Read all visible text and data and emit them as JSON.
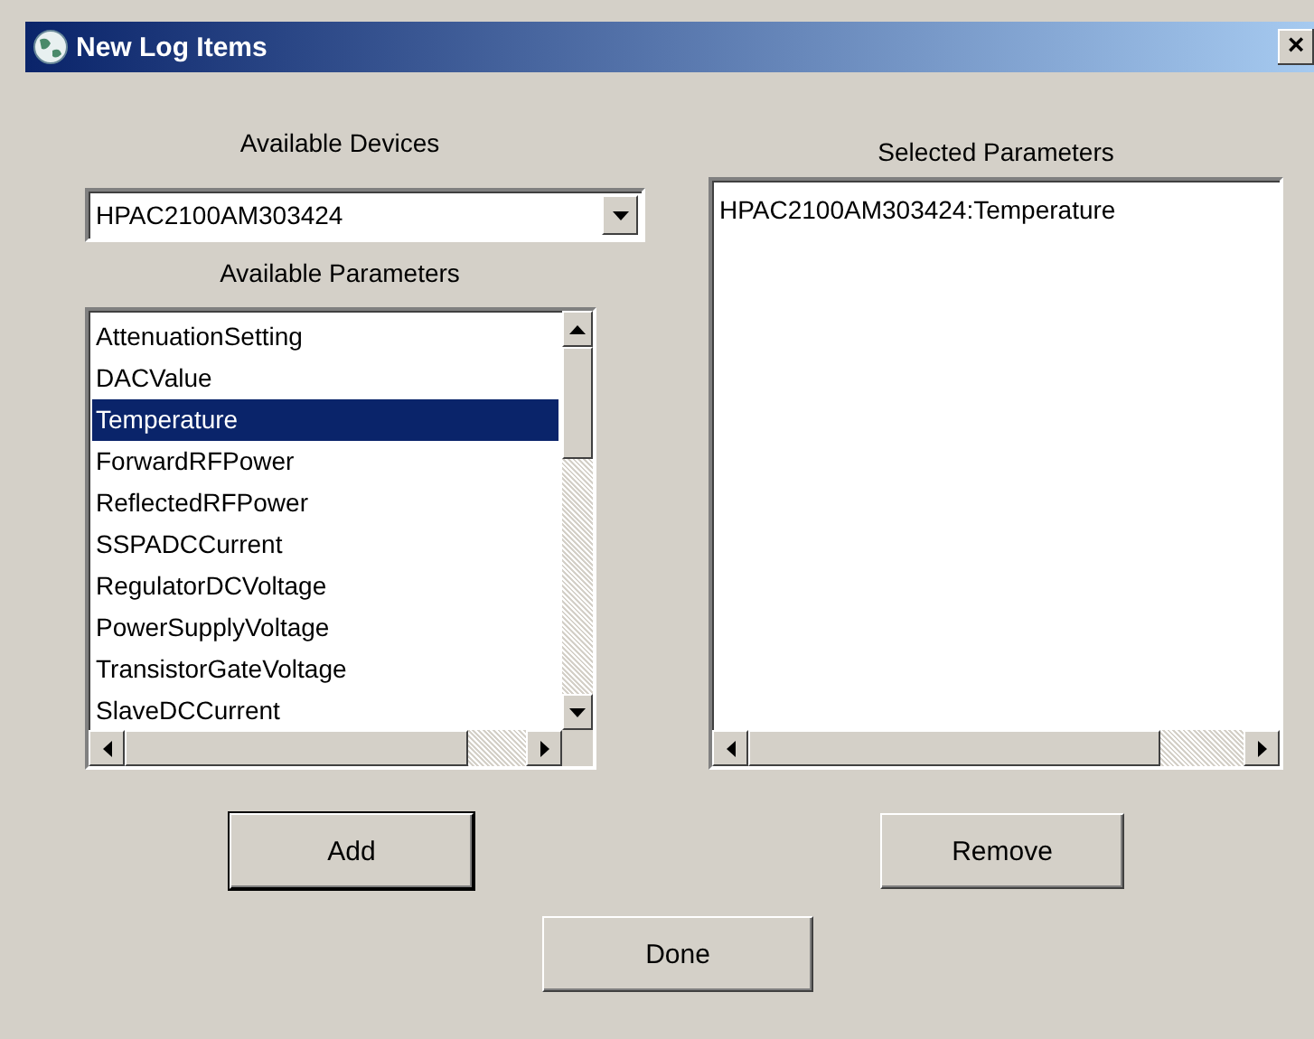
{
  "window": {
    "title": "New Log Items",
    "close": "×"
  },
  "devices": {
    "label": "Available Devices",
    "value": "HPAC2100AM303424"
  },
  "parameters": {
    "label": "Available Parameters",
    "items": [
      {
        "text": "AttenuationSetting",
        "selected": false
      },
      {
        "text": "DACValue",
        "selected": false
      },
      {
        "text": "Temperature",
        "selected": true
      },
      {
        "text": "ForwardRFPower",
        "selected": false
      },
      {
        "text": "ReflectedRFPower",
        "selected": false
      },
      {
        "text": "SSPADCCurrent",
        "selected": false
      },
      {
        "text": "RegulatorDCVoltage",
        "selected": false
      },
      {
        "text": "PowerSupplyVoltage",
        "selected": false
      },
      {
        "text": "TransistorGateVoltage",
        "selected": false
      },
      {
        "text": "SlaveDCCurrent",
        "selected": false
      }
    ]
  },
  "selected_parameters": {
    "label": "Selected Parameters",
    "items": [
      "HPAC2100AM303424:Temperature"
    ]
  },
  "buttons": [
    {
      "label": "Add",
      "default": true
    },
    {
      "label": "Remove",
      "default": false
    },
    {
      "label": "Done",
      "default": false
    }
  ]
}
